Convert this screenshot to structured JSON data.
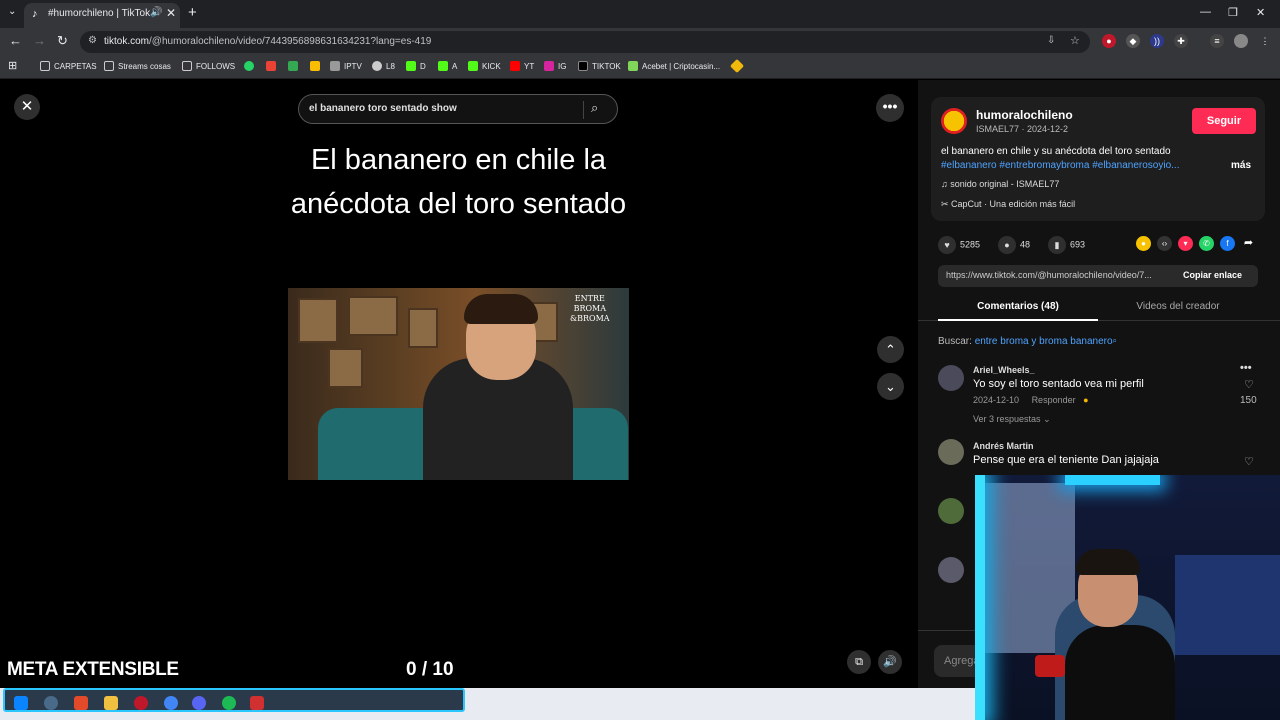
{
  "browser": {
    "tab_title": "#humorchileno | TikTok",
    "url_host": "tiktok.com",
    "url_path": "/@humoralochileno/video/7443956898631634231?lang=es-419",
    "bookmarks": [
      "CARPETAS",
      "Streams cosas",
      "FOLLOWS",
      "IPTV",
      "L8",
      "D",
      "A",
      "KICK",
      "YT",
      "IG",
      "TIKTOK",
      "Acebet | Criptocasin..."
    ]
  },
  "video": {
    "search_query": "el bananero toro sentado show",
    "caption": "El bananero en chile la anécdota del toro sentado",
    "watermark": "ENTRE BROMA & BROMA"
  },
  "creator": {
    "username": "humoralochileno",
    "subline": "ISMAEL77 · 2024-12-2",
    "follow_label": "Seguir",
    "description": "el bananero en chile y su anécdota del toro sentado",
    "hashtags": "#elbananero #entrebromaybroma #elbananerosoyio...",
    "more_label": "más",
    "sound": "sonido original - ISMAEL77",
    "capcut": "CapCut · Una edición más fácil"
  },
  "stats": {
    "likes": "5285",
    "comments": "48",
    "saves": "693"
  },
  "share": {
    "link": "https://www.tiktok.com/@humoralochileno/video/7...",
    "copy_label": "Copiar enlace"
  },
  "tabs": {
    "comments": "Comentarios (48)",
    "creator_videos": "Videos del creador"
  },
  "search_hint": {
    "prefix": "Buscar:",
    "query": "entre broma y broma bananero"
  },
  "comments": [
    {
      "user": "Ariel_Wheels_",
      "text": "Yo soy el toro sentado vea mi perfil",
      "date": "2024-12-10",
      "reply": "Responder",
      "likes": "150",
      "replies": "Ver 3 respuestas"
    },
    {
      "user": "Andrés Martin",
      "text": "Pense que era el teniente Dan jajajaja"
    }
  ],
  "comment_placeholder": "Agrega",
  "overlay": {
    "label": "META EXTENSIBLE",
    "counter": "0  / 10"
  },
  "colors": {
    "accent": "#fe2c55",
    "link": "#4fa3ff"
  }
}
